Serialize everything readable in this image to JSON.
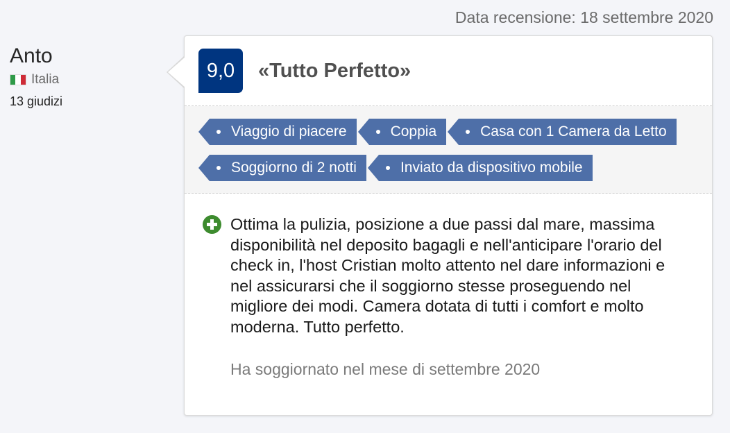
{
  "review_date": "Data recensione: 18 settembre 2020",
  "reviewer": {
    "name": "Anto",
    "country": "Italia",
    "country_flag_icon": "italy-flag-icon",
    "reviews_count": "13 giudizi"
  },
  "review": {
    "score": "9,0",
    "title": "«Tutto Perfetto»",
    "tags_row1": [
      "Viaggio di piacere",
      "Coppia",
      "Casa con 1 Camera da Letto"
    ],
    "tags_row2": [
      "Soggiorno di 2 notti",
      "Inviato da dispositivo mobile"
    ],
    "positive_icon": "plus-circle-icon",
    "positive_text": "Ottima la pulizia, posizione a due passi dal mare, massima disponibilità nel deposito bagagli e nell'anticipare l'orario del check in, l'host Cristian molto attento nel dare informazioni e nel assicurarsi che il soggiorno stesse proseguendo nel migliore dei modi. Camera dotata di tutti i comfort e molto moderna. Tutto perfetto.",
    "stay_date": "Ha soggiornato nel mese di settembre 2020"
  },
  "colors": {
    "score_bg": "#003580",
    "tag_bg": "#4e6fa8",
    "positive_icon": "#3d8b2e"
  }
}
